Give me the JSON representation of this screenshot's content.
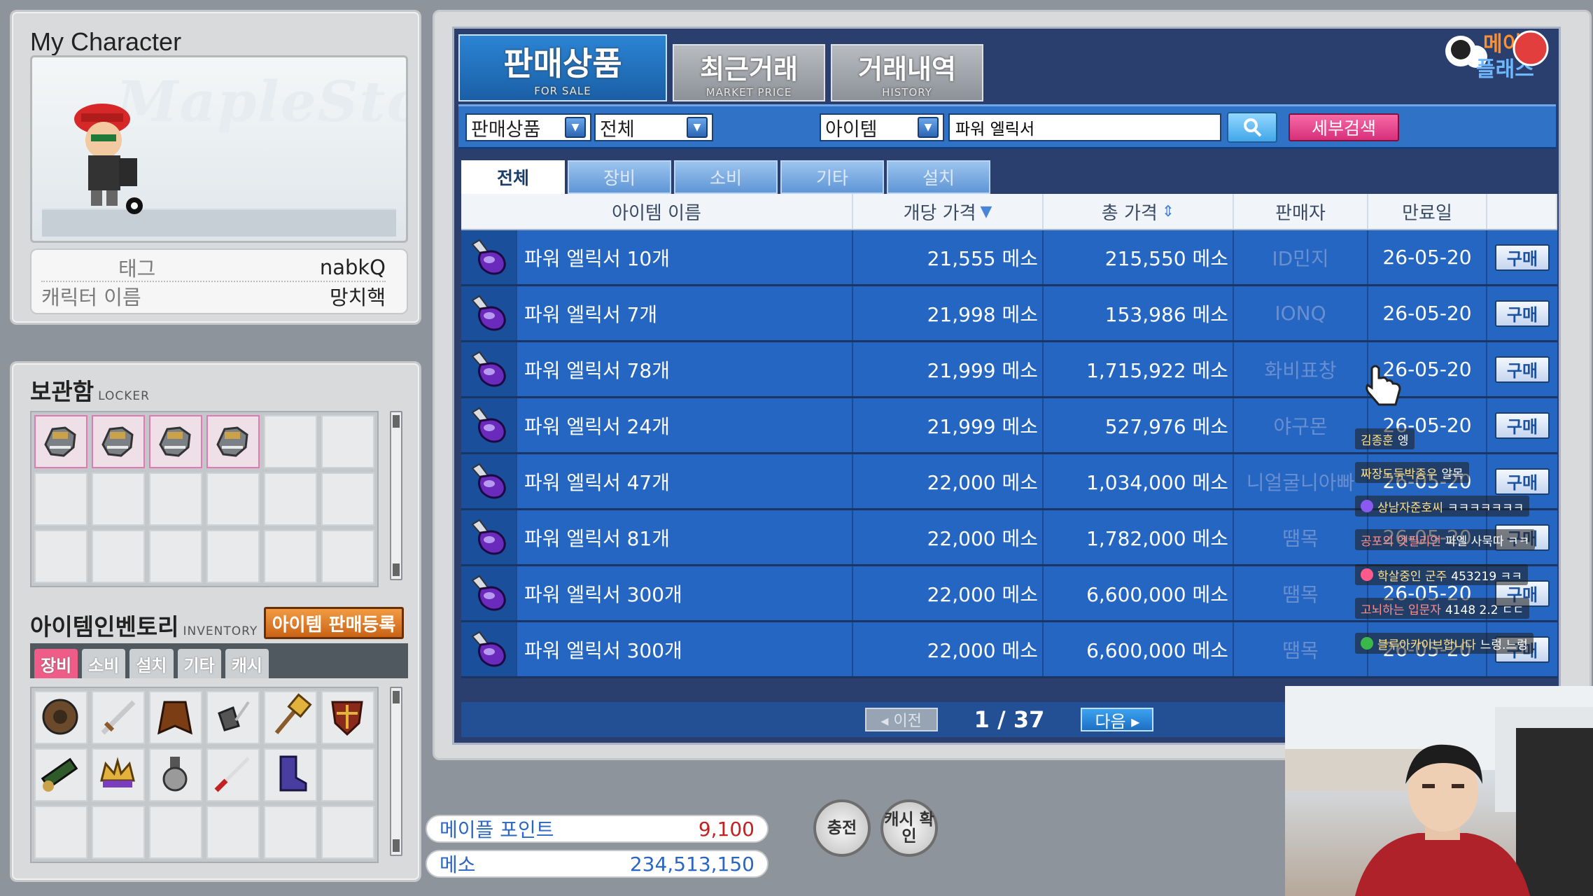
{
  "character": {
    "title": "My Character",
    "logo_text": "MapleStory",
    "tag_label": "태그",
    "tag_value": "nabkQ",
    "name_label": "캐릭터 이름",
    "name_value": "망치핵"
  },
  "locker": {
    "title": "보관함",
    "subtitle": "LOCKER",
    "slots": 18,
    "filled_icon": "gauntlet-icon"
  },
  "inventory": {
    "title": "아이템인벤토리",
    "subtitle": "INVENTORY",
    "sell_register_label": "아이템 판매등록",
    "tabs": [
      "장비",
      "소비",
      "설치",
      "기타",
      "캐시"
    ],
    "active_tab": "장비",
    "items": [
      "shield-icon",
      "sword-icon",
      "cape-icon",
      "claw-icon",
      "hammer-icon",
      "guard-shield-icon",
      "cannon-icon",
      "crown-icon",
      "medal-icon",
      "katana-icon",
      "boots-icon"
    ]
  },
  "market": {
    "tabs": [
      {
        "label": "판매상품",
        "sub": "FOR SALE"
      },
      {
        "label": "최근거래",
        "sub": "MARKET PRICE"
      },
      {
        "label": "거래내역",
        "sub": "HISTORY"
      }
    ],
    "filter": {
      "category": "판매상품",
      "type": "전체",
      "search_type": "아이템",
      "search_value": "파워 엘릭서",
      "detail_search_label": "세부검색"
    },
    "category_tabs": [
      "전체",
      "장비",
      "소비",
      "기타",
      "설치"
    ],
    "columns": [
      "아이템 이름",
      "개당 가격",
      "총 가격",
      "판매자",
      "만료일"
    ],
    "buy_label": "구매",
    "rows": [
      {
        "name": "파워 엘릭서 10개",
        "unit": "21,555 메소",
        "total": "215,550 메소",
        "seller": "ID민지",
        "expires": "26-05-20"
      },
      {
        "name": "파워 엘릭서 7개",
        "unit": "21,998 메소",
        "total": "153,986 메소",
        "seller": "IONQ",
        "expires": "26-05-20"
      },
      {
        "name": "파워 엘릭서 78개",
        "unit": "21,999 메소",
        "total": "1,715,922 메소",
        "seller": "화비표창",
        "expires": "26-05-20"
      },
      {
        "name": "파워 엘릭서 24개",
        "unit": "21,999 메소",
        "total": "527,976 메소",
        "seller": "야구몬",
        "expires": "26-05-20"
      },
      {
        "name": "파워 엘릭서 47개",
        "unit": "22,000 메소",
        "total": "1,034,000 메소",
        "seller": "니얼굴니아빠",
        "expires": "26-05-20"
      },
      {
        "name": "파워 엘릭서 81개",
        "unit": "22,000 메소",
        "total": "1,782,000 메소",
        "seller": "땜목",
        "expires": "26-05-20"
      },
      {
        "name": "파워 엘릭서 300개",
        "unit": "22,000 메소",
        "total": "6,600,000 메소",
        "seller": "땜목",
        "expires": "26-05-20"
      },
      {
        "name": "파워 엘릭서 300개",
        "unit": "22,000 메소",
        "total": "6,600,000 메소",
        "seller": "땜목",
        "expires": "26-05-20"
      }
    ],
    "pager": {
      "prev": "◂ 이전",
      "page": "1 / 37",
      "next": "다음 ▸"
    }
  },
  "wallet": {
    "points_label": "메이플 포인트",
    "points_value": "9,100",
    "meso_label": "메소",
    "meso_value": "234,513,150",
    "charge_label": "충전",
    "cash_check_label": "캐시 확인"
  },
  "chat": [
    {
      "user": "김종훈",
      "text": "엥"
    },
    {
      "user": "짜장도둑박종우",
      "text": "알목"
    },
    {
      "user": "상남자준호씨",
      "text": "ㅋㅋㅋㅋㅋㅋㅋ"
    },
    {
      "user": "공포의 엣필리언",
      "text": "파엘 사묵따 ㅋㅋ"
    },
    {
      "user": "학살중인 군주",
      "text": "453219 ㅋㅋ"
    },
    {
      "user": "고뇌하는 입문자",
      "text": "4148 2.2 ㄷㄷ"
    },
    {
      "user": "블루아카이브합니다",
      "text": "느렁.느렁"
    }
  ],
  "colors": {
    "window_bg": "#2a3f6e",
    "row_bg": "#2466c2",
    "active_tab": "#1a5fa6",
    "detail_search": "#d72f7b",
    "sell_register": "#c96316"
  }
}
